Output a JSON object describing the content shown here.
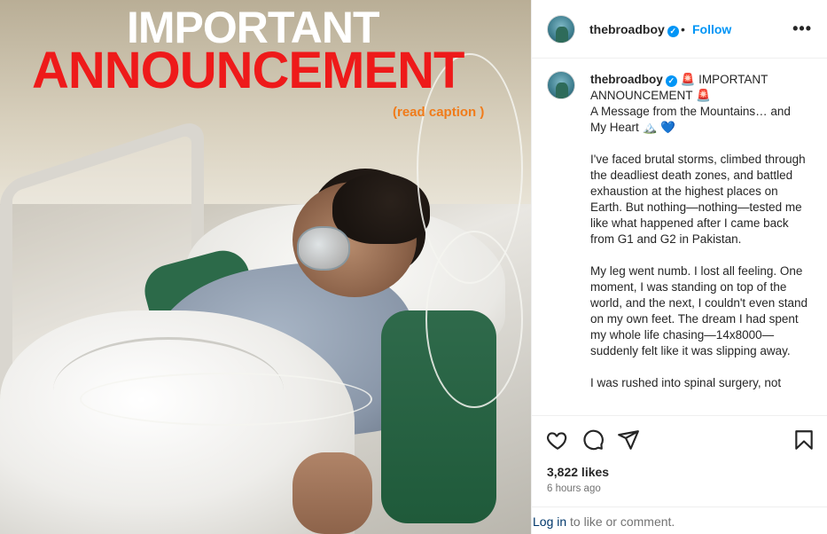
{
  "media": {
    "headline_line1": "IMPORTANT",
    "headline_line2": "ANNOUNCEMENT",
    "caption_note": "(read caption )"
  },
  "header": {
    "username": "thebroadboy",
    "verified": "✓",
    "separator": "•",
    "follow_label": "Follow",
    "more_label": "•••"
  },
  "caption": {
    "username": "thebroadboy",
    "verified": "✓",
    "paragraphs": [
      "🚨 IMPORTANT ANNOUNCEMENT 🚨\nA Message from the Mountains… and My Heart 🏔️ 💙",
      "I've faced brutal storms, climbed through the deadliest death zones, and battled exhaustion at the highest places on Earth. But nothing—nothing—tested me like what happened after I came back from G1 and G2 in Pakistan.",
      "My leg went numb. I lost all feeling. One moment, I was standing on top of the world, and the next, I couldn't even stand on my own feet. The dream I had spent my whole life chasing—14x8000—suddenly felt like it was slipping away.",
      "I was rushed into spinal surgery, not"
    ]
  },
  "actions": {
    "icons": [
      "heart-icon",
      "comment-icon",
      "share-icon",
      "save-icon"
    ],
    "likes": "3,822 likes",
    "time_ago": "6 hours ago"
  },
  "footer": {
    "login_link": "Log in",
    "login_rest": " to like or comment."
  },
  "colors": {
    "accent": "#0095f6",
    "headline_red": "#ee1a1a",
    "caption_orange": "#f07b1a"
  }
}
